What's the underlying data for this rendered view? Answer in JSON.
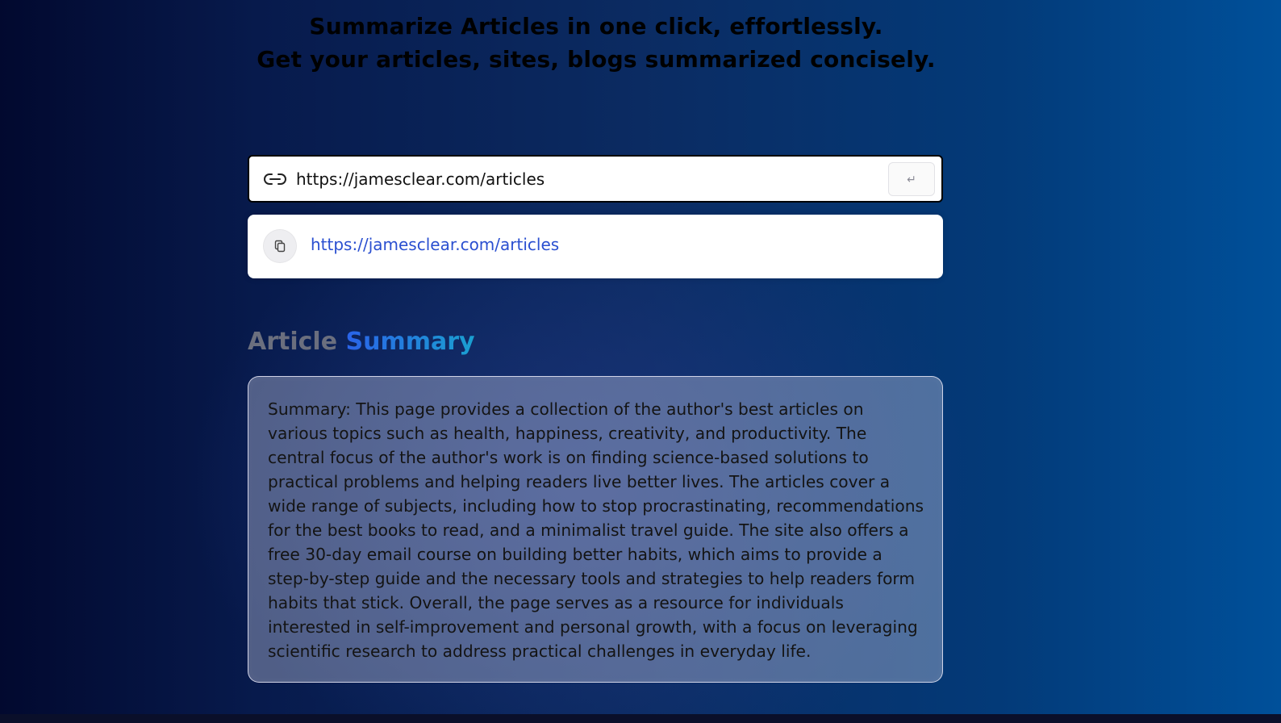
{
  "hero": {
    "line1": "Summarize Articles in one click, effortlessly.",
    "line2": "Get your articles, sites, blogs summarized concisely."
  },
  "url_form": {
    "value": "https://jamesclear.com/articles",
    "submit_label": "↵",
    "icon": "link-icon"
  },
  "history": {
    "items": [
      {
        "url": "https://jamesclear.com/articles",
        "icon": "copy-icon"
      }
    ]
  },
  "result": {
    "title_prefix": "Article",
    "title_highlight": "Summary",
    "summary": "Summary: This page provides a collection of the author's best articles on various topics such as health, happiness, creativity, and productivity. The central focus of the author's work is on finding science-based solutions to practical problems and helping readers live better lives. The articles cover a wide range of subjects, including how to stop procrastinating, recommendations for the best books to read, and a minimalist travel guide. The site also offers a free 30-day email course on building better habits, which aims to provide a step-by-step guide and the necessary tools and strategies to help readers form habits that stick. Overall, the page serves as a resource for individuals interested in self-improvement and personal growth, with a focus on leveraging scientific research to address practical challenges in everyday life."
  },
  "colors": {
    "background_left": "#02092f",
    "background_right": "#00509a",
    "link_blue": "#2a4fd0",
    "summary_accent_start": "#2a63e8",
    "summary_accent_end": "#1aa0d0"
  }
}
